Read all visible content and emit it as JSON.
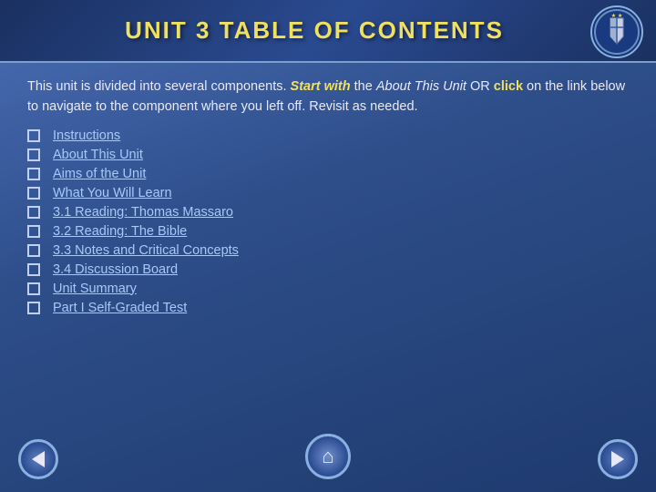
{
  "header": {
    "title": "UNIT 3 TABLE OF CONTENTS"
  },
  "intro": {
    "text_part1": "This unit is divided into several components. ",
    "start_with": "Start with",
    "text_part2": " the ",
    "about_italic": "About This Unit",
    "text_part3": " OR ",
    "click": "click",
    "text_part4": " on the link below to navigate to the component where you left off. Revisit as needed."
  },
  "nav_items": [
    {
      "label": "Instructions"
    },
    {
      "label": "About This Unit"
    },
    {
      "label": "Aims of the Unit"
    },
    {
      "label": "What You Will Learn"
    },
    {
      "label": "3.1 Reading: Thomas Massaro"
    },
    {
      "label": "3.2 Reading: The Bible"
    },
    {
      "label": "3.3 Notes and Critical Concepts"
    },
    {
      "label": "3.4 Discussion Board"
    },
    {
      "label": "Unit Summary"
    },
    {
      "label": "Part I Self-Graded Test"
    }
  ],
  "buttons": {
    "prev_label": "◀",
    "home_label": "⌂",
    "next_label": "▶"
  }
}
